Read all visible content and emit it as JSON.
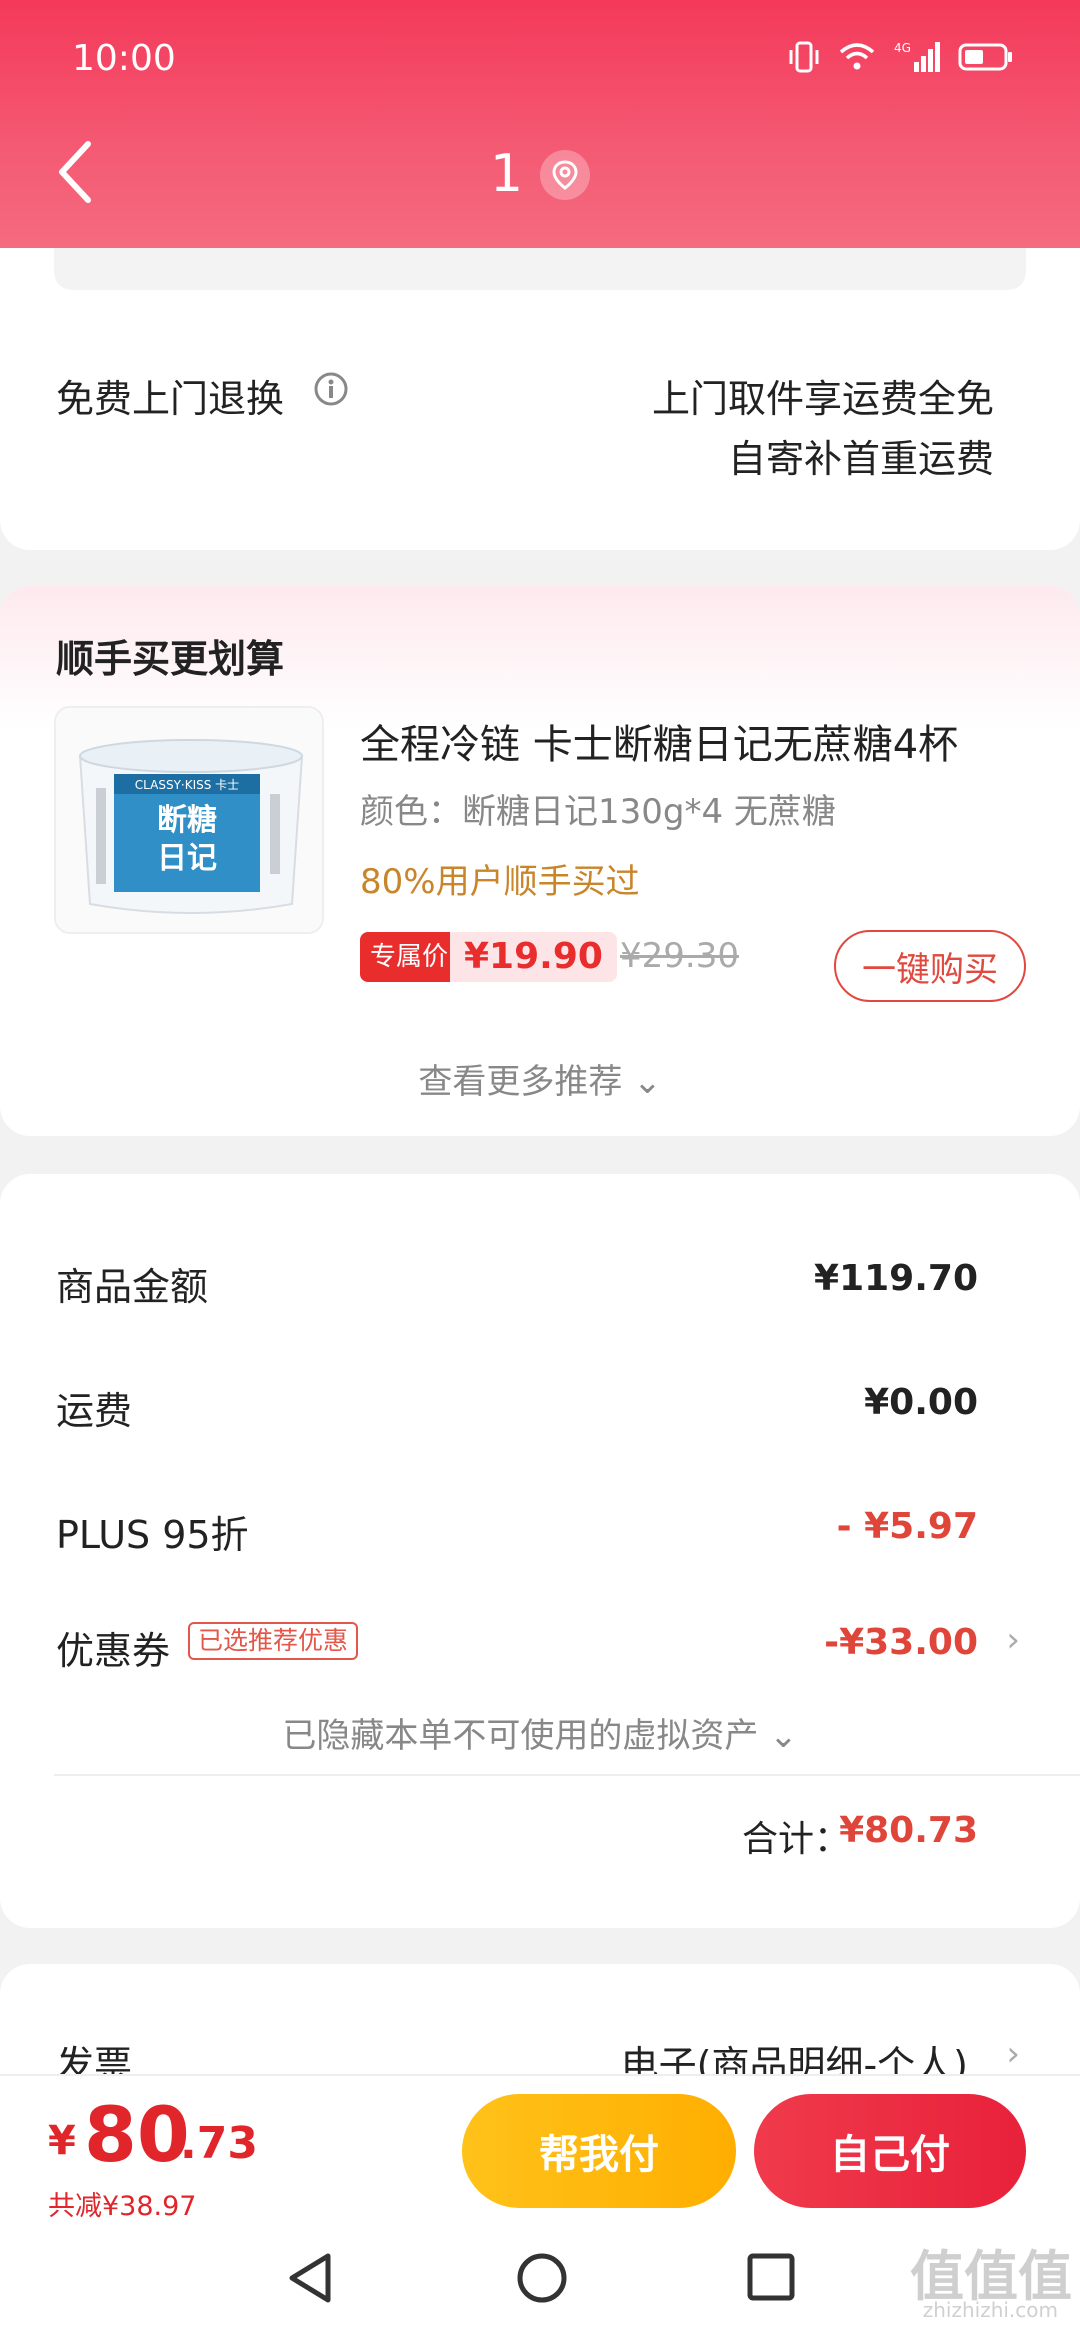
{
  "status_bar": {
    "time": "10:00",
    "network": "4G"
  },
  "header": {
    "title": "1"
  },
  "return_card": {
    "title": "免费上门退换",
    "line1": "上门取件享运费全免",
    "line2": "自寄补首重运费"
  },
  "recommend": {
    "title": "顺手买更划算",
    "product": {
      "name": "全程冷链 卡士断糖日记无蔗糖4杯",
      "spec": "颜色：断糖日记130g*4 无蔗糖",
      "bought": "80%用户顺手买过",
      "price_tag": "专属价",
      "price": "¥19.90",
      "old_price": "¥29.30",
      "buy_label": "一键购买",
      "image_brand": "CLASSY·KISS 卡士",
      "image_title_1": "断糖",
      "image_title_2": "日记"
    },
    "more_label": "查看更多推荐 ⌄"
  },
  "summary": {
    "goods_label": "商品金额",
    "goods_value": "¥119.70",
    "shipping_label": "运费",
    "shipping_value": "¥0.00",
    "plus_label": "PLUS 95折",
    "plus_value": "- ¥5.97",
    "coupon_label": "优惠券",
    "coupon_badge": "已选推荐优惠",
    "coupon_value": "-¥33.00",
    "hidden_label": "已隐藏本单不可使用的虚拟资产 ⌄",
    "total_label": "合计：",
    "total_value": "¥80.73"
  },
  "invoice": {
    "label": "发票",
    "value": "电子(商品明细-个人)"
  },
  "paybar": {
    "currency": "¥",
    "amount_int": "80",
    "amount_dec": ".73",
    "saved": "共减¥38.97",
    "help_label": "帮我付",
    "self_label": "自己付"
  },
  "watermark": {
    "text": "值值值",
    "sub": "zhizhizhi.com"
  },
  "colors": {
    "accent": "#e0262b",
    "header": "#f4395a",
    "gold": "#ffb800"
  }
}
